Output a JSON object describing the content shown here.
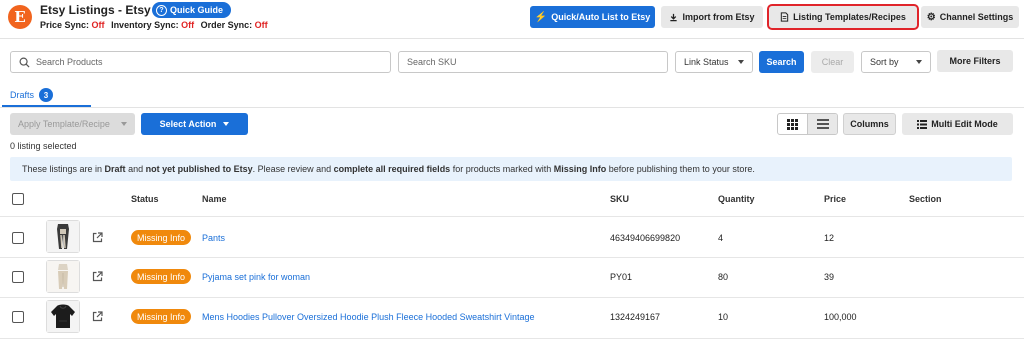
{
  "header": {
    "logo_letter": "E",
    "title": "Etsy Listings - Etsy",
    "quick_guide": "Quick Guide",
    "sync": [
      {
        "label": "Price Sync:",
        "value": "Off"
      },
      {
        "label": "Inventory Sync:",
        "value": "Off"
      },
      {
        "label": "Order Sync:",
        "value": "Off"
      }
    ],
    "buttons": {
      "quick_list": "Quick/Auto List to Etsy",
      "import": "Import from Etsy",
      "templates": "Listing Templates/Recipes",
      "channel_settings": "Channel Settings"
    }
  },
  "filters": {
    "search_products_placeholder": "Search Products",
    "search_sku_placeholder": "Search SKU",
    "link_status": "Link Status",
    "search": "Search",
    "clear": "Clear",
    "sort_by": "Sort by",
    "more_filters": "More Filters"
  },
  "tabs": [
    {
      "label": "Drafts",
      "count": "3"
    }
  ],
  "actions": {
    "apply_template": "Apply Template/Recipe",
    "select_action": "Select Action",
    "columns": "Columns",
    "multi_edit": "Multi Edit Mode"
  },
  "selection_count": "0 listing selected",
  "banner": {
    "t1": "These listings are in ",
    "b1": "Draft",
    "t2": " and ",
    "b2": "not yet published to Etsy",
    "t3": ". Please review and ",
    "b3": "complete all required fields",
    "t4": " for products marked with ",
    "b4": "Missing Info",
    "t5": " before publishing them to your store."
  },
  "table": {
    "columns": [
      "Status",
      "Name",
      "SKU",
      "Quantity",
      "Price",
      "Section"
    ],
    "rows": [
      {
        "status": "Missing Info",
        "name": "Pants",
        "sku": "46349406699820",
        "quantity": "4",
        "price": "12",
        "section": "",
        "thumb": "pants-photo"
      },
      {
        "status": "Missing Info",
        "name": "Pyjama set pink for woman",
        "sku": "PY01",
        "quantity": "80",
        "price": "39",
        "section": "",
        "thumb": "pyjama-photo"
      },
      {
        "status": "Missing Info",
        "name": "Mens Hoodies Pullover Oversized Hoodie Plush Fleece Hooded Sweatshirt Vintage",
        "sku": "1324249167",
        "quantity": "10",
        "price": "100,000",
        "section": "",
        "thumb": "hoodie-photo"
      }
    ]
  },
  "colors": {
    "accent": "#1a6fd8",
    "warning": "#f0890c",
    "off": "#e02424",
    "highlight": "#e0242a"
  }
}
